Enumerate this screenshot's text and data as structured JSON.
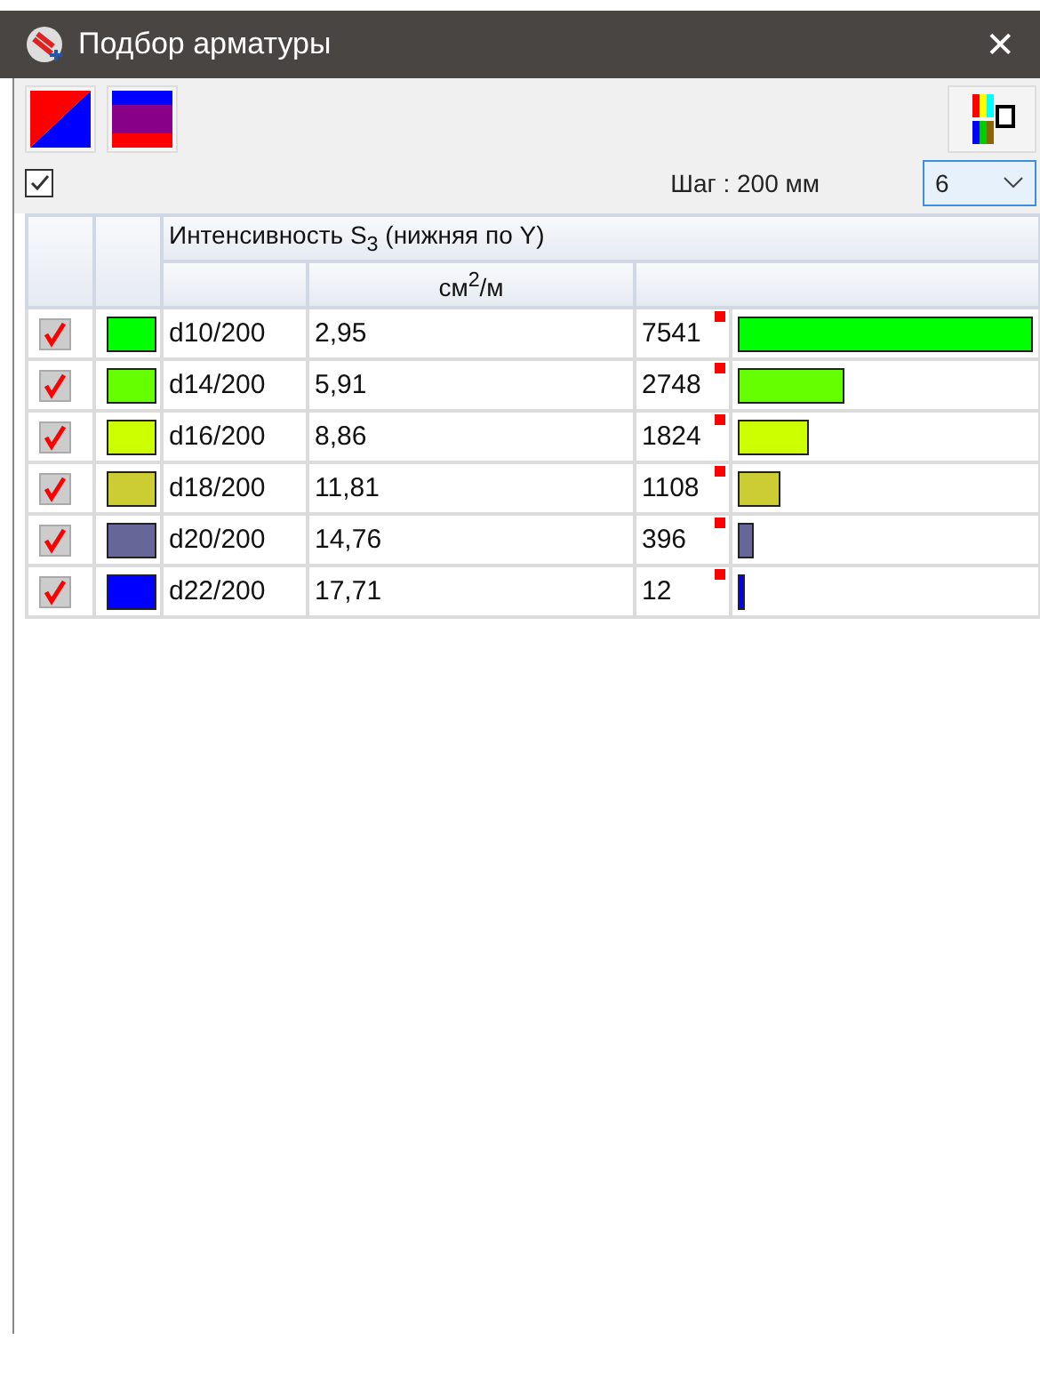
{
  "window": {
    "title": "Подбор арматуры",
    "close": "✕"
  },
  "toolbar": {
    "show_all": true,
    "step_label": "Шаг : 200 мм",
    "count_select": "6"
  },
  "table": {
    "group_header": "Интенсивность S$_{3}$ (нижняя по Y)",
    "unit_header": "см$^{2}$/м",
    "rows": [
      {
        "checked": true,
        "color": "#00ff00",
        "name": "d10/200",
        "value": "2,95",
        "count": "7541",
        "level": 1
      },
      {
        "checked": true,
        "color": "#66ff00",
        "name": "d14/200",
        "value": "5,91",
        "count": "2748",
        "level": 0.364
      },
      {
        "checked": true,
        "color": "#ccff00",
        "name": "d16/200",
        "value": "8,86",
        "count": "1824",
        "level": 0.242
      },
      {
        "checked": true,
        "color": "#cccc33",
        "name": "d18/200",
        "value": "11,81",
        "count": "1108",
        "level": 0.147
      },
      {
        "checked": true,
        "color": "#666699",
        "name": "d20/200",
        "value": "14,76",
        "count": "396",
        "level": 0.053
      },
      {
        "checked": true,
        "color": "#0000ff",
        "name": "d22/200",
        "value": "17,71",
        "count": "12",
        "level": 0.002
      }
    ]
  }
}
